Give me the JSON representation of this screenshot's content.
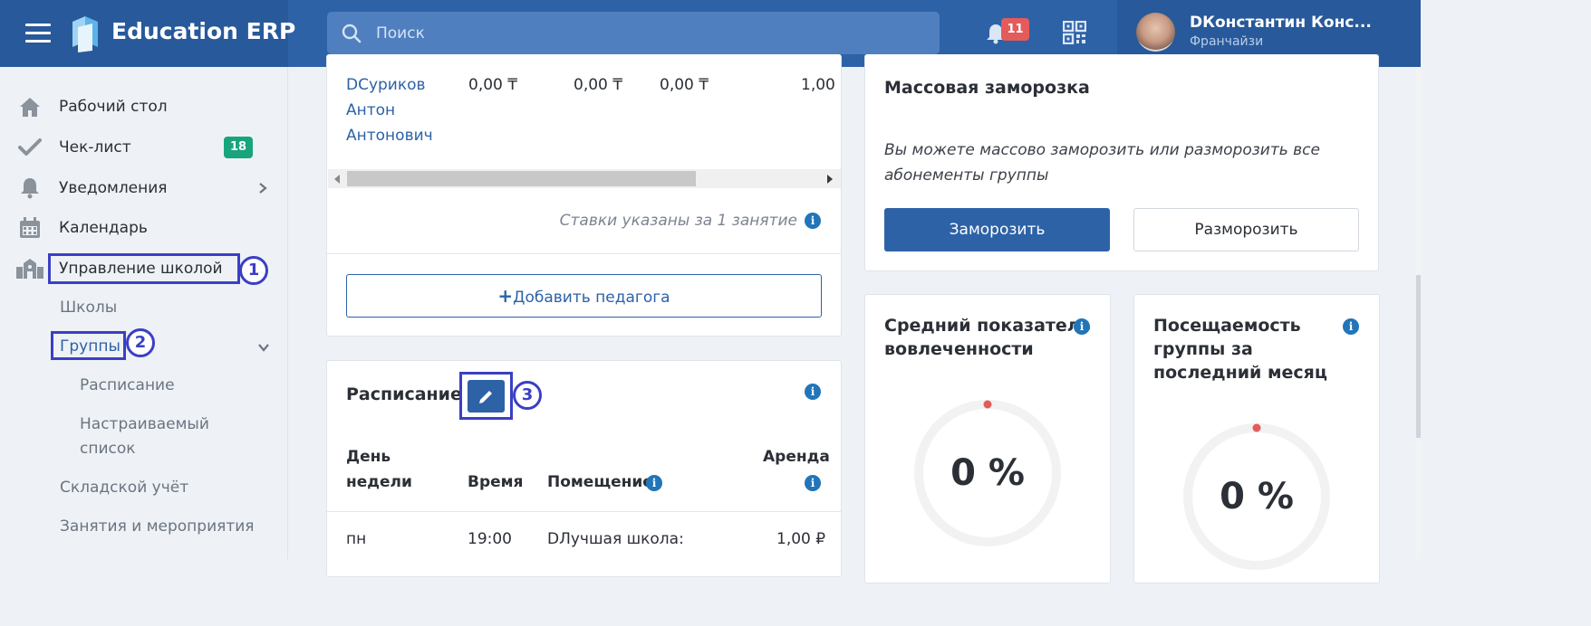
{
  "app": {
    "title": "Education ERP"
  },
  "header": {
    "search_placeholder": "Поиск",
    "notifications_count": "11",
    "user_name": "DКонстантин Конс...",
    "user_role": "Франчайзи"
  },
  "sidebar": {
    "items": [
      {
        "label": "Рабочий стол",
        "icon": "home-icon"
      },
      {
        "label": "Чек-лист",
        "icon": "check-icon",
        "badge": "18"
      },
      {
        "label": "Уведомления",
        "icon": "bell-icon"
      },
      {
        "label": "Календарь",
        "icon": "calendar-icon"
      },
      {
        "label": "Управление школой",
        "icon": "school-icon"
      }
    ],
    "sub_items": [
      "Школы",
      "Группы",
      "Расписание",
      "Настраиваемый",
      "список",
      "Складской учёт",
      "Занятия и мероприятия"
    ]
  },
  "annotations": [
    "1",
    "2",
    "3"
  ],
  "teachers": {
    "teacher_name_lines": [
      "DСуриков",
      "Антон",
      "Антонович"
    ],
    "rates": [
      "0,00 ₸",
      "0,00 ₸",
      "0,00 ₸",
      "1,00"
    ],
    "note": "Ставки указаны за 1 занятие",
    "add_button": "Добавить педагога"
  },
  "schedule": {
    "title": "Расписание",
    "headers": {
      "day_line1": "День",
      "day_line2": "недели",
      "time": "Время",
      "room": "Помещение",
      "rent": "Аренда"
    },
    "rows": [
      {
        "day": "пн",
        "time": "19:00",
        "room": "DЛучшая школа:",
        "rent": "1,00 ₽"
      }
    ]
  },
  "freeze": {
    "title": "Массовая заморозка",
    "description_line1": "Вы можете массово заморозить или разморозить все",
    "description_line2": "абонементы группы",
    "freeze_button": "Заморозить",
    "unfreeze_button": "Разморозить"
  },
  "engagement": {
    "title_line1": "Средний показатель",
    "title_line2": "вовлеченности",
    "value": "0 %"
  },
  "attendance": {
    "title_line1": "Посещаемость",
    "title_line2": "группы за",
    "title_line3": "последний месяц",
    "value": "0 %"
  },
  "colors": {
    "brand": "#2d62a7",
    "header_dark": "#28599a",
    "badge_red": "#e45b5b",
    "badge_green": "#18a57d",
    "annotation": "#3b3fc4"
  }
}
